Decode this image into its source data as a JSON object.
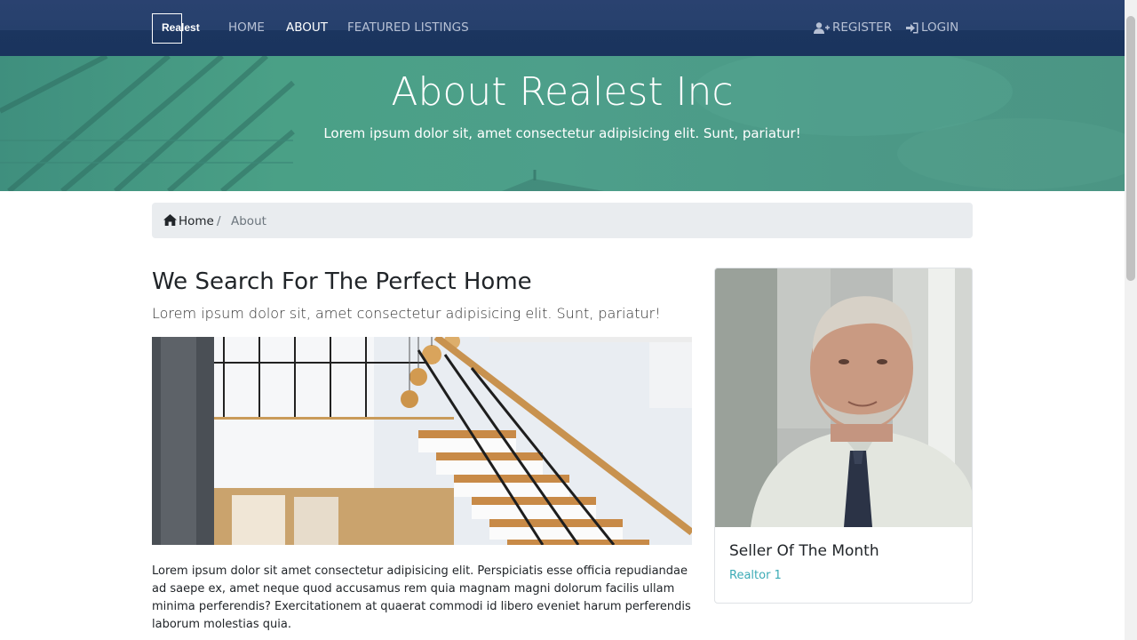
{
  "nav": {
    "logo": "Realest",
    "links": [
      "HOME",
      "ABOUT",
      "FEATURED LISTINGS"
    ],
    "register": "REGISTER",
    "login": "LOGIN",
    "active": "ABOUT"
  },
  "hero": {
    "title": "About Realest Inc",
    "subtitle": "Lorem ipsum dolor sit, amet consectetur adipisicing elit. Sunt, pariatur!"
  },
  "breadcrumb": {
    "home": "Home",
    "separator": "/",
    "current": "About"
  },
  "main": {
    "heading": "We Search For The Perfect Home",
    "lead": "Lorem ipsum dolor sit, amet consectetur adipisicing elit. Sunt, pariatur!",
    "paragraph": "Lorem ipsum dolor sit amet consectetur adipisicing elit. Perspiciatis esse officia repudiandae ad saepe ex, amet neque quod accusamus rem quia magnam magni dolorum facilis ullam minima perferendis? Exercitationem at quaerat commodi id libero eveniet harum perferendis laborum molestias quia."
  },
  "card": {
    "title": "Seller Of The Month",
    "subtitle": "Realtor 1"
  },
  "icons": {
    "register": "user-plus-icon",
    "login": "sign-in-icon",
    "home": "home-icon"
  },
  "colors": {
    "navbar": "#26406c",
    "hero": "#4d9f8a",
    "accent": "#3cabb6",
    "breadcrumb_bg": "#e9ecef"
  }
}
